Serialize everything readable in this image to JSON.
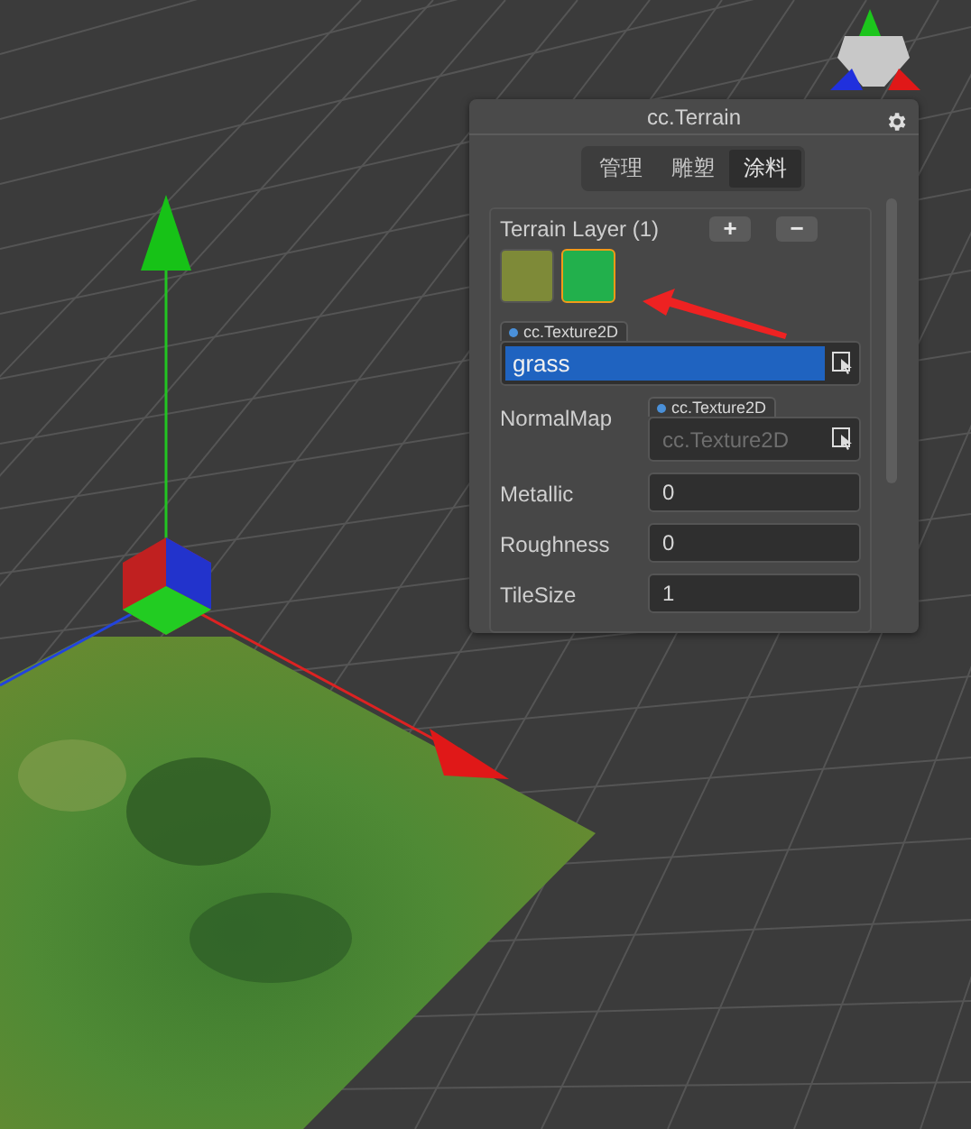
{
  "panel": {
    "title": "cc.Terrain",
    "tabs": [
      {
        "label": "管理",
        "selected": false
      },
      {
        "label": "雕塑",
        "selected": false
      },
      {
        "label": "涂料",
        "selected": true
      }
    ],
    "layer_section": {
      "title": "Terrain Layer (1)",
      "add": "+",
      "remove": "−",
      "layers": [
        {
          "color": "#7e8a38",
          "selected": false
        },
        {
          "color": "#22b04c",
          "selected": true
        }
      ],
      "texture": {
        "type": "cc.Texture2D",
        "value": "grass"
      }
    },
    "properties": [
      {
        "kind": "asset",
        "label": "NormalMap",
        "type": "cc.Texture2D",
        "placeholder": "cc.Texture2D"
      },
      {
        "kind": "number",
        "label": "Metallic",
        "value": "0"
      },
      {
        "kind": "number",
        "label": "Roughness",
        "value": "0"
      },
      {
        "kind": "number",
        "label": "TileSize",
        "value": "1"
      }
    ]
  }
}
